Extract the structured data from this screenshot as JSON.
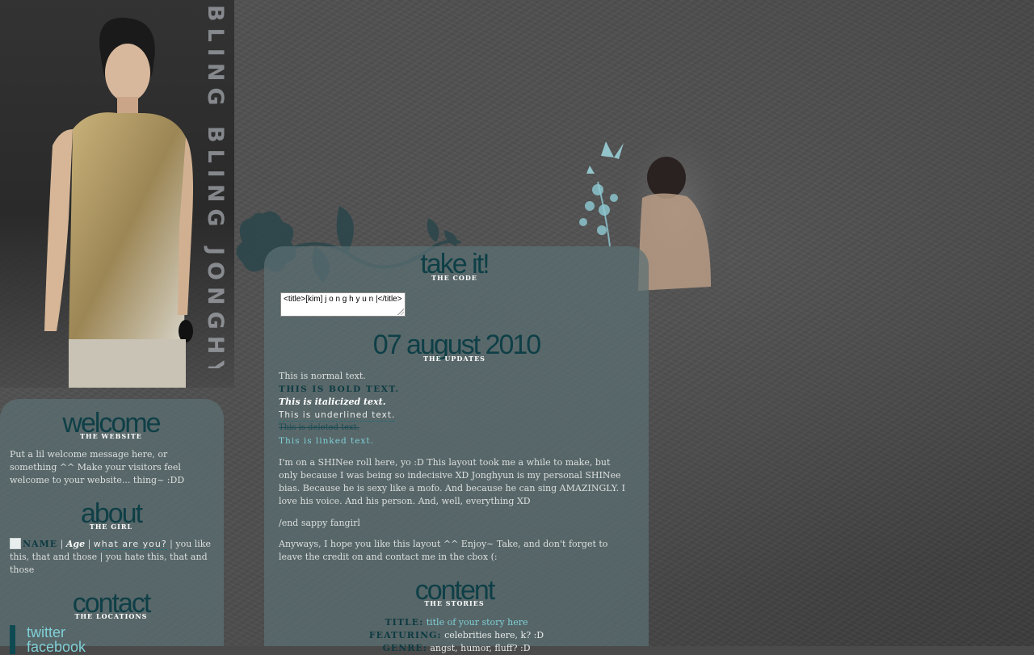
{
  "sidebar_art": {
    "vertical_text": "BLING BLING JONGHYUN"
  },
  "code_section": {
    "heading": "take it!",
    "subheading": "THE CODE",
    "code_text": "<title>[kim] j o n g h y u n |</title>"
  },
  "updates": {
    "heading": "07 august 2010",
    "subheading": "THE UPDATES",
    "normal": "This is normal text.",
    "bold": "THIS IS BOLD TEXT.",
    "italic": "This is italicized text.",
    "underline": "This is underlined text.",
    "strike": "This is deleted text.",
    "link": "This is linked text.",
    "para1": "I'm on a SHINee roll here, yo :D This layout took me a while to make, but only because I was being so indecisive XD Jonghyun is my personal SHINee bias. Because he is sexy like a mofo. And because he can sing AMAZINGLY. I love his voice. And his person. And, well, everything XD",
    "para2": "/end sappy fangirl",
    "para3": "Anyways, I hope you like this layout ^^ Enjoy~ Take, and don't forget to leave the credit on and contact me in the cbox (:"
  },
  "welcome": {
    "heading": "welcome",
    "subheading": "THE WEBSITE",
    "text": "Put a lil welcome message here, or something ^^ Make your visitors feel welcome to your website... thing~ :DD"
  },
  "about": {
    "heading": "about",
    "subheading": "THE GIRL",
    "name": "NAME",
    "sep1": " | ",
    "age": "Age",
    "sep2": " | ",
    "what": "what are you?",
    "rest": " | you like this, that and those | you hate this, that and those"
  },
  "contact": {
    "heading": "contact",
    "subheading": "THE LOCATIONS",
    "links": [
      "twitter",
      "facebook"
    ]
  },
  "content": {
    "heading": "content",
    "subheading": "THE STORIES",
    "title_label": "TITLE:",
    "title_value": "title of your story here",
    "featuring_label": "FEATURING:",
    "featuring_value": "celebrities here, k? :D",
    "genre_label": "GENRE:",
    "genre_value": "angst, humor, fluff? :D"
  },
  "colors": {
    "panel": "#5c7073",
    "heading": "#0e3f47",
    "link": "#7fd0d8"
  }
}
